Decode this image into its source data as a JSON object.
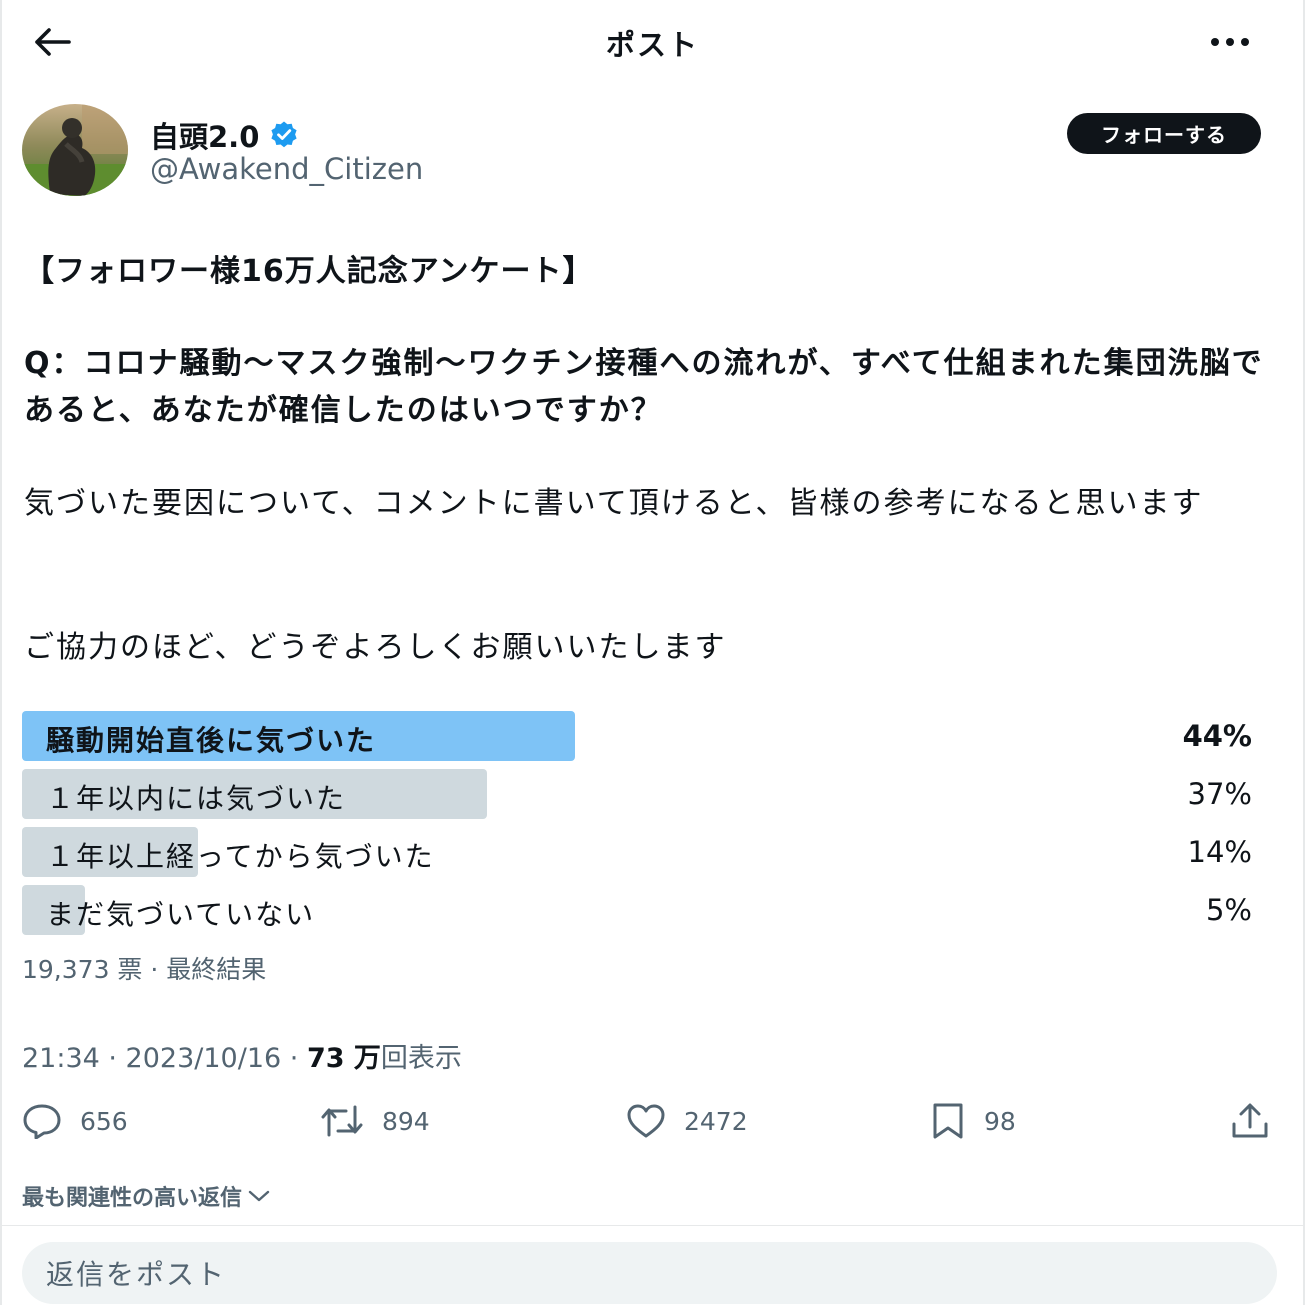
{
  "header": {
    "title": "ポスト",
    "back_icon": "arrow-left-icon",
    "more_icon": "more-horizontal-icon"
  },
  "author": {
    "name": "自頭2.0",
    "handle": "@Awakend_Citizen",
    "verified": true,
    "follow_label": "フォローする"
  },
  "post": {
    "line_title": "【フォロワー様16万人記念アンケート】",
    "question": "Q：コロナ騒動〜マスク強制〜ワクチン接種への流れが、すべて仕組まれた集団洗脳であると、あなたが確信したのはいつですか？",
    "request": "気づいた要因について、コメントに書いて頂けると、皆様の参考になると思います",
    "closing": "ご協力のほど、どうぞよろしくお願いいたします"
  },
  "poll": {
    "options": [
      {
        "label": "騒動開始直後に気づいた",
        "percent": "44%",
        "value": 44,
        "winner": true
      },
      {
        "label": "１年以内には気づいた",
        "percent": "37%",
        "value": 37,
        "winner": false
      },
      {
        "label": "１年以上経ってから気づいた",
        "percent": "14%",
        "value": 14,
        "winner": false
      },
      {
        "label": "まだ気づいていない",
        "percent": "5%",
        "value": 5,
        "winner": false
      }
    ],
    "meta": "19,373 票 · 最終結果"
  },
  "meta": {
    "time": "21:34 · 2023/10/16 · ",
    "views_count": "73 万",
    "views_label": "回表示"
  },
  "actions": {
    "replies": "656",
    "reposts": "894",
    "likes": "2472",
    "bookmarks": "98"
  },
  "replies_sort_label": "最も関連性の高い返信",
  "reply_placeholder": "返信をポスト",
  "colors": {
    "winner_bar": "#7ec3f6",
    "bar": "#cfd9de",
    "verified": "#1d9bf0"
  }
}
